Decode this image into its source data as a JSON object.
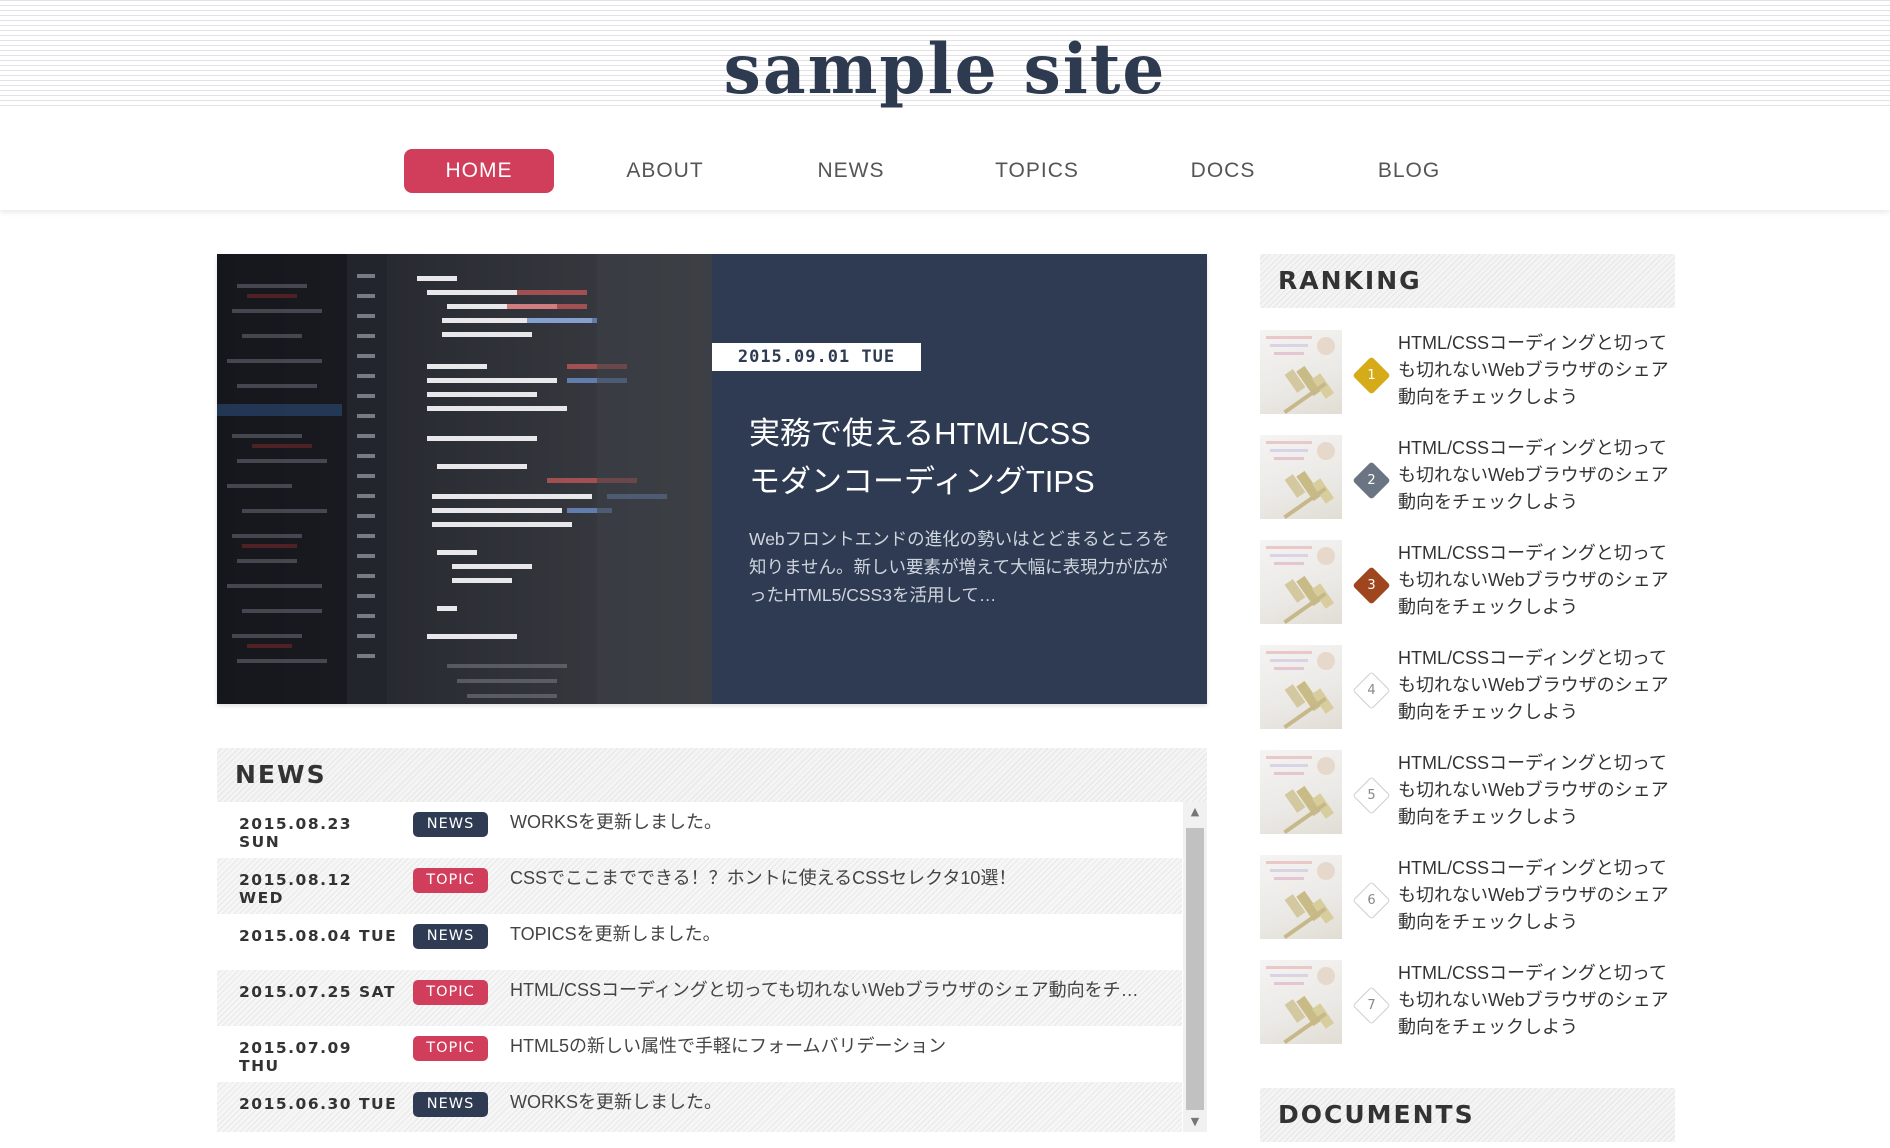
{
  "site": {
    "logo": "sample site"
  },
  "nav": {
    "items": [
      {
        "label": "HOME",
        "active": true
      },
      {
        "label": "ABOUT",
        "active": false
      },
      {
        "label": "NEWS",
        "active": false
      },
      {
        "label": "TOPICS",
        "active": false
      },
      {
        "label": "DOCS",
        "active": false
      },
      {
        "label": "BLOG",
        "active": false
      }
    ]
  },
  "hero": {
    "date": "2015.09.01 TUE",
    "title_line1": "実務で使えるHTML/CSS",
    "title_line2": "モダンコーディングTIPS",
    "excerpt": "Webフロントエンドの進化の勢いはとどまるところを知りません。新しい要素が増えて大幅に表現力が広がったHTML5/CSS3を活用して…"
  },
  "news": {
    "heading": "NEWS",
    "rows": [
      {
        "date": "2015.08.23 SUN",
        "badge": "NEWS",
        "text": "WORKSを更新しました。"
      },
      {
        "date": "2015.08.12 WED",
        "badge": "TOPIC",
        "text": "CSSでここまでできる！？ホントに使えるCSSセレクタ10選！"
      },
      {
        "date": "2015.08.04 TUE",
        "badge": "NEWS",
        "text": "TOPICSを更新しました。"
      },
      {
        "date": "2015.07.25 SAT",
        "badge": "TOPIC",
        "text": "HTML/CSSコーディングと切っても切れないWebブラウザのシェア動向をチ…"
      },
      {
        "date": "2015.07.09 THU",
        "badge": "TOPIC",
        "text": "HTML5の新しい属性で手軽にフォームバリデーション"
      },
      {
        "date": "2015.06.30 TUE",
        "badge": "NEWS",
        "text": "WORKSを更新しました。"
      }
    ]
  },
  "ranking": {
    "heading": "RANKING",
    "items": [
      {
        "rank": "1",
        "line1": "HTML/CSSコーディングと切って",
        "line2": "も切れないWebブラウザのシェア",
        "line3": "動向をチェックしよう"
      },
      {
        "rank": "2",
        "line1": "HTML/CSSコーディングと切って",
        "line2": "も切れないWebブラウザのシェア",
        "line3": "動向をチェックしよう"
      },
      {
        "rank": "3",
        "line1": "HTML/CSSコーディングと切って",
        "line2": "も切れないWebブラウザのシェア",
        "line3": "動向をチェックしよう"
      },
      {
        "rank": "4",
        "line1": "HTML/CSSコーディングと切って",
        "line2": "も切れないWebブラウザのシェア",
        "line3": "動向をチェックしよう"
      },
      {
        "rank": "5",
        "line1": "HTML/CSSコーディングと切って",
        "line2": "も切れないWebブラウザのシェア",
        "line3": "動向をチェックしよう"
      },
      {
        "rank": "6",
        "line1": "HTML/CSSコーディングと切って",
        "line2": "も切れないWebブラウザのシェア",
        "line3": "動向をチェックしよう"
      },
      {
        "rank": "7",
        "line1": "HTML/CSSコーディングと切って",
        "line2": "も切れないWebブラウザのシェア",
        "line3": "動向をチェックしよう"
      }
    ]
  },
  "documents": {
    "heading": "DOCUMENTS"
  },
  "colors": {
    "accent": "#d13e5b",
    "navy": "#2e3b52",
    "rank_gold": "#d6ab1a",
    "rank_silver": "#6b7482",
    "rank_bronze": "#a0461f"
  }
}
